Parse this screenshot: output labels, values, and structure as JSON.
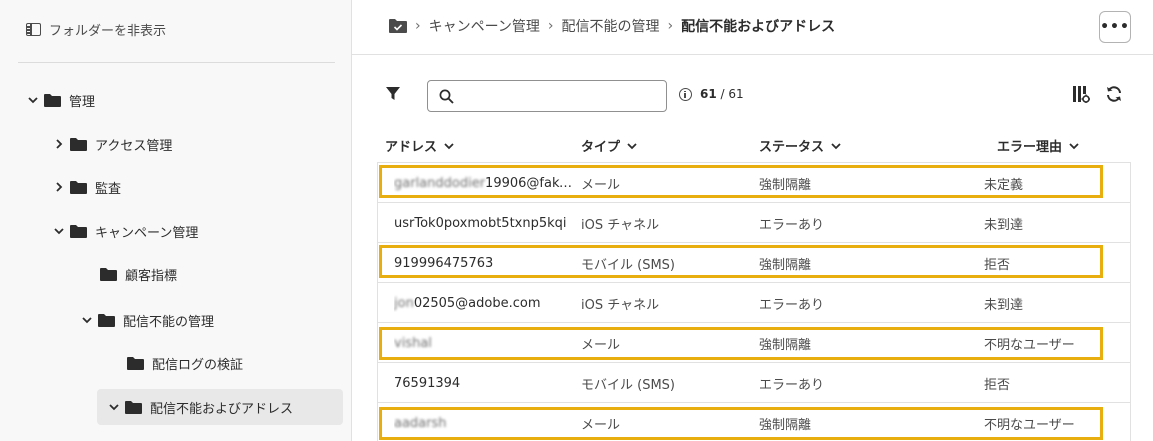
{
  "sidebar": {
    "hide_folders_label": "フォルダーを非表示",
    "tree": [
      {
        "label": "管理",
        "expanded": true,
        "has_chevron": true
      },
      {
        "label": "アクセス管理",
        "expanded": false,
        "has_chevron": true
      },
      {
        "label": "監査",
        "expanded": false,
        "has_chevron": true
      },
      {
        "label": "キャンペーン管理",
        "expanded": true,
        "has_chevron": true
      },
      {
        "label": "顧客指標",
        "has_chevron": false
      },
      {
        "label": "配信不能の管理",
        "expanded": true,
        "has_chevron": true
      },
      {
        "label": "配信ログの検証",
        "has_chevron": false
      },
      {
        "label": "配信不能およびアドレス",
        "expanded": true,
        "has_chevron": true,
        "selected": true
      }
    ]
  },
  "breadcrumb": {
    "items": [
      "キャンペーン管理",
      "配信不能の管理"
    ],
    "current": "配信不能およびアドレス",
    "separator": "›"
  },
  "toolbar": {
    "more_label": "•••",
    "search_placeholder": "",
    "count_shown": "61",
    "count_total": "61",
    "count_separator": "/"
  },
  "table": {
    "columns": [
      "アドレス",
      "タイプ",
      "ステータス",
      "エラー理由"
    ],
    "rows": [
      {
        "address_blur": "garlanddodier",
        "address": "19906@fake_...",
        "type": "メール",
        "status": "強制隔離",
        "reason": "未定義",
        "highlighted": true
      },
      {
        "address_blur": "",
        "address": "usrTok0poxmobt5txnp5kqi",
        "type": "iOS チャネル",
        "status": "エラーあり",
        "reason": "未到達",
        "highlighted": false
      },
      {
        "address_blur": "",
        "address": "919996475763",
        "type": "モバイル (SMS)",
        "status": "強制隔離",
        "reason": "拒否",
        "highlighted": true
      },
      {
        "address_blur": "jon",
        "address": "02505@adobe.com",
        "type": "iOS チャネル",
        "status": "エラーあり",
        "reason": "未到達",
        "highlighted": false
      },
      {
        "address_blur": "vishal",
        "address": "",
        "type": "メール",
        "status": "強制隔離",
        "reason": "不明なユーザー",
        "highlighted": true
      },
      {
        "address_blur": "",
        "address": "76591394",
        "type": "モバイル (SMS)",
        "status": "エラーあり",
        "reason": "拒否",
        "highlighted": false
      },
      {
        "address_blur": "aadarsh",
        "address": "",
        "type": "メール",
        "status": "強制隔離",
        "reason": "不明なユーザー",
        "highlighted": true
      }
    ]
  },
  "colors": {
    "highlight": "#e8ad0f",
    "sidebar_bg": "#f8f8f8",
    "selected_bg": "#e8e8e8"
  }
}
